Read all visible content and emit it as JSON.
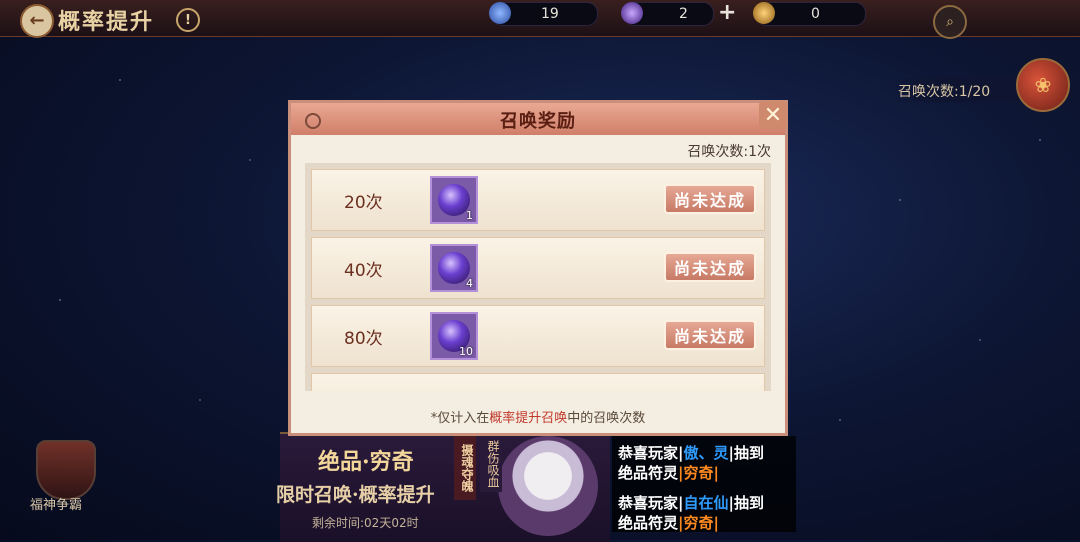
{
  "header": {
    "title": "概率提升",
    "info_symbol": "!",
    "back_symbol": "←",
    "plus_symbol": "+",
    "search_symbol": "⌕"
  },
  "currencies": [
    {
      "icon": "crystal-icon",
      "value": "19"
    },
    {
      "icon": "purple-orb-icon",
      "value": "2"
    },
    {
      "icon": "gold-coin-icon",
      "value": "0"
    }
  ],
  "summon_counter": {
    "label": "召唤次数:1/20"
  },
  "bag_symbol": "❀",
  "left_emblem": {
    "label": "福神争霸"
  },
  "banner": {
    "title": "绝品·穷奇",
    "subtitle": "限时召唤·概率提升",
    "timer": "剩余时间:02天02时",
    "tag1": "摄魂夺魄",
    "tag2": "群伤吸血"
  },
  "broadcast": [
    {
      "prefix": "恭喜玩家",
      "sep1": "|",
      "name": "傲、灵",
      "sep2": "|",
      "verb": "抽到",
      "line2_prefix": "绝品符灵",
      "item": "|穷奇|"
    },
    {
      "prefix": "恭喜玩家",
      "sep1": "|",
      "name": "自在仙",
      "sep2": "|",
      "verb": "抽到",
      "line2_prefix": "绝品符灵",
      "item": "|穷奇|"
    }
  ],
  "modal": {
    "title": "召唤奖励",
    "count_label": "召唤次数:1次",
    "close_symbol": "✕",
    "rows": [
      {
        "label": "20次",
        "qty": "1",
        "status": "尚未达成"
      },
      {
        "label": "40次",
        "qty": "4",
        "status": "尚未达成"
      },
      {
        "label": "80次",
        "qty": "10",
        "status": "尚未达成"
      }
    ],
    "footnote": {
      "prefix": "*仅计入在",
      "highlight": "概率提升召唤",
      "suffix": "中的召唤次数"
    }
  },
  "colors": {
    "accent": "#d07f69",
    "panel": "#f4ede2",
    "name_blue": "#2f9cff",
    "item_orange": "#ff8a1f"
  }
}
